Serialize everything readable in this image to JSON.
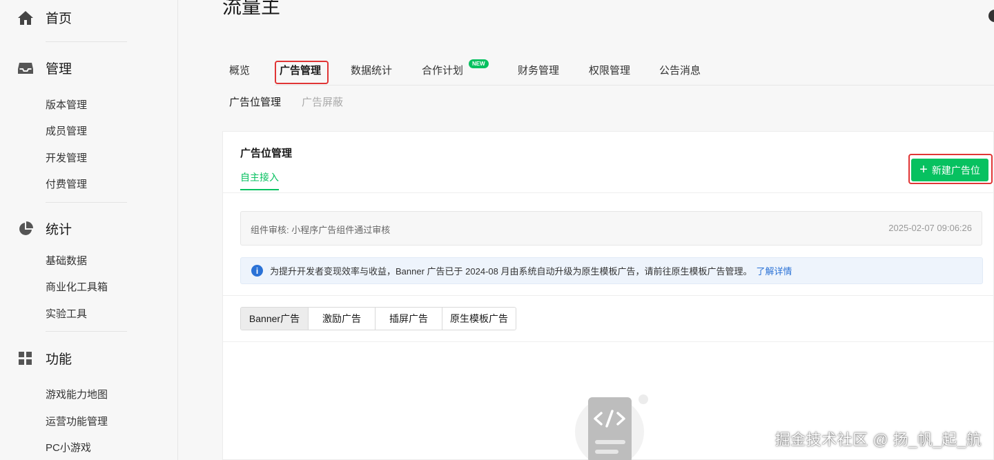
{
  "sidebar": {
    "sections": [
      {
        "label": "首页",
        "icon": "home-icon",
        "items": []
      },
      {
        "label": "管理",
        "icon": "inbox-icon",
        "items": [
          "版本管理",
          "成员管理",
          "开发管理",
          "付费管理"
        ]
      },
      {
        "label": "统计",
        "icon": "pie-chart-icon",
        "items": [
          "基础数据",
          "商业化工具箱",
          "实验工具"
        ]
      },
      {
        "label": "功能",
        "icon": "grid-icon",
        "items": [
          "游戏能力地图",
          "运营功能管理",
          "PC小游戏"
        ]
      }
    ]
  },
  "header": {
    "title": "流量主"
  },
  "tabs": [
    {
      "label": "概览"
    },
    {
      "label": "广告管理",
      "active": true
    },
    {
      "label": "数据统计"
    },
    {
      "label": "合作计划",
      "badge": "NEW"
    },
    {
      "label": "财务管理"
    },
    {
      "label": "权限管理"
    },
    {
      "label": "公告消息"
    }
  ],
  "subtabs": [
    {
      "label": "广告位管理",
      "active": true
    },
    {
      "label": "广告屏蔽",
      "active": false
    }
  ],
  "card": {
    "title": "广告位管理",
    "tab": "自主接入",
    "new_button": "新建广告位",
    "review": {
      "text": "组件审核: 小程序广告组件通过审核",
      "time": "2025-02-07 09:06:26"
    },
    "notice": {
      "text": "为提升开发者变现效率与收益，Banner 广告已于 2024-08 月由系统自动升级为原生模板广告，请前往原生模板广告管理。",
      "link": "了解详情"
    },
    "segments": [
      {
        "label": "Banner广告",
        "active": true
      },
      {
        "label": "激励广告",
        "active": false
      },
      {
        "label": "插屏广告",
        "active": false
      },
      {
        "label": "原生模板广告",
        "active": false
      }
    ],
    "empty_icon": "code-file-icon"
  },
  "watermark": "掘金技术社区 @ 扬_帆_起_航",
  "colors": {
    "accent": "#07c160",
    "highlight": "#e03535",
    "link": "#2b72d6"
  }
}
